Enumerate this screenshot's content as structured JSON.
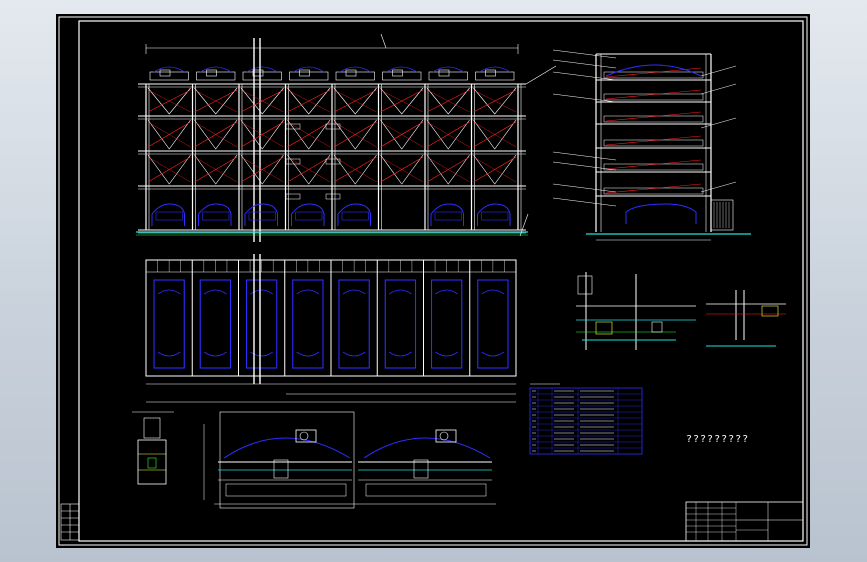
{
  "viewer": {
    "background": "#c9d2dc"
  },
  "sheet": {
    "background": "#000000",
    "line_color": "#ffffff"
  },
  "colors": {
    "frame": "#ffffff",
    "structure": "#ffffff",
    "cars": "#2d2dff",
    "braces": "#ff2020",
    "cyan": "#20e0e0",
    "green": "#30ff30",
    "yellow": "#ffff40",
    "magenta": "#ff40ff"
  },
  "drawing": {
    "front_elevation": {
      "columns": 9,
      "levels": 4
    },
    "side_elevation": {
      "levels": 5
    },
    "plan_view": {
      "bays": 8
    },
    "note_text": "?????????"
  }
}
